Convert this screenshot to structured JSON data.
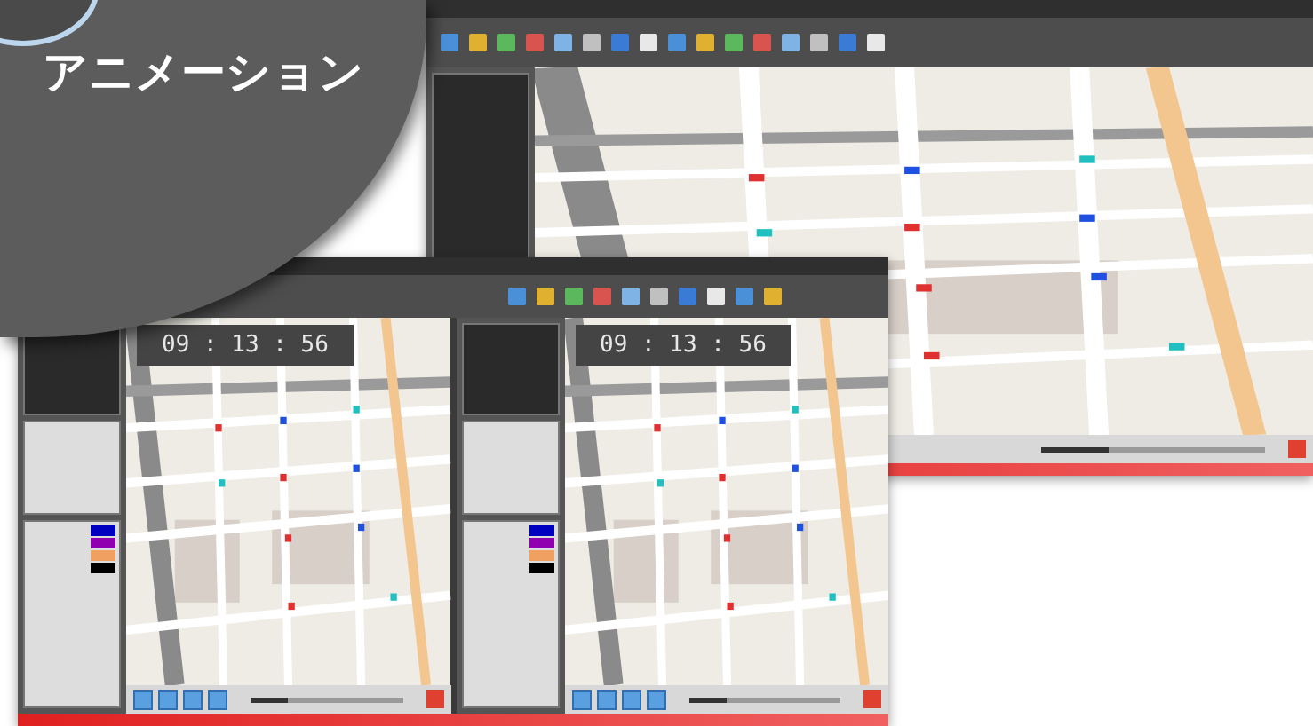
{
  "badge": {
    "title": "アニメーション"
  },
  "back_window": {
    "playback": {
      "level": 0.3
    }
  },
  "front_window": {
    "panes": [
      {
        "clock": "09 : 13 : 56",
        "playback": {
          "level": 0.25
        },
        "legend": [
          {
            "color": "#0000c0"
          },
          {
            "color": "#9000b0"
          },
          {
            "color": "#f0a060"
          },
          {
            "color": "#000000"
          }
        ]
      },
      {
        "clock": "09 : 13 : 56",
        "playback": {
          "level": 0.25
        },
        "legend": [
          {
            "color": "#0000c0"
          },
          {
            "color": "#9000b0"
          },
          {
            "color": "#f0a060"
          },
          {
            "color": "#000000"
          }
        ]
      }
    ]
  }
}
